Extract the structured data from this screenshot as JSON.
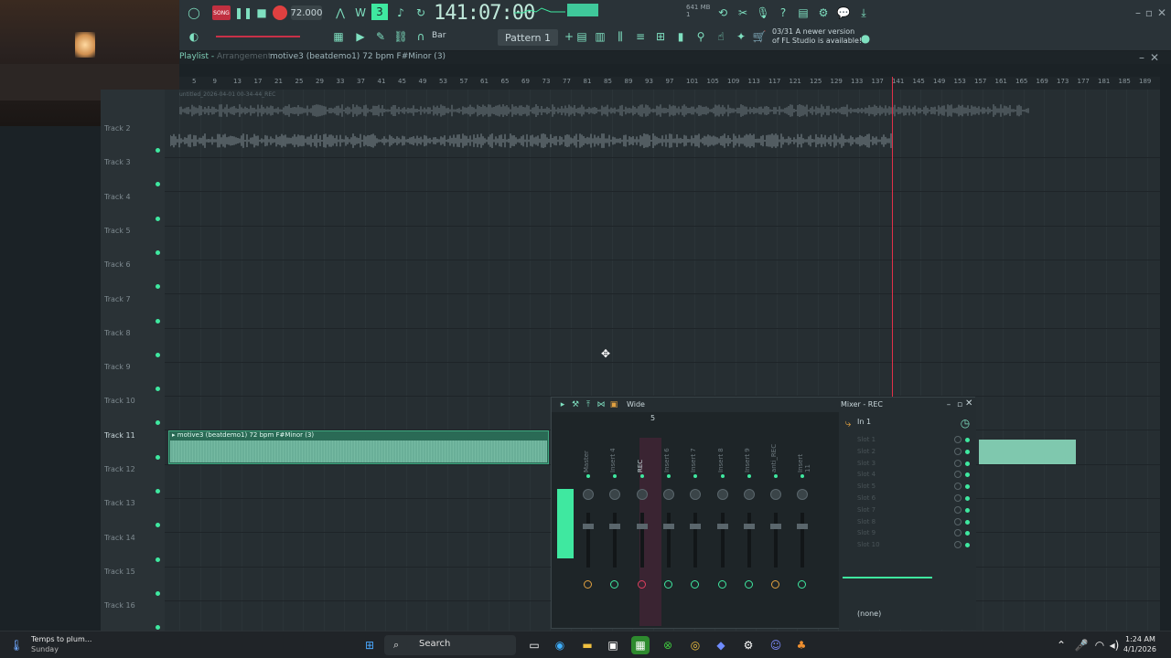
{
  "toolbar": {
    "song_badge": "SONG",
    "tempo": "72.000",
    "time": "141:07:00",
    "snap": "Bar",
    "pattern": "Pattern 1",
    "memory": "641 MB",
    "memory_sub": "1",
    "news_date": "03/31",
    "news_text": "A newer version of FL Studio is available!"
  },
  "playlist": {
    "title": "Playlist",
    "subtitle": "Arrangement",
    "pattern_name": "motive3 (beatdemo1) 72 bpm F#Minor (3)",
    "rec_clip_label": "untitled_2026-04-01 00-34-44_REC",
    "ruler_ticks": [
      "5",
      "9",
      "13",
      "17",
      "21",
      "25",
      "29",
      "33",
      "37",
      "41",
      "45",
      "49",
      "53",
      "57",
      "61",
      "65",
      "69",
      "73",
      "77",
      "81",
      "85",
      "89",
      "93",
      "97",
      "101",
      "105",
      "109",
      "113",
      "117",
      "121",
      "125",
      "129",
      "133",
      "137",
      "141",
      "145",
      "149",
      "153",
      "157",
      "161",
      "165",
      "169",
      "173",
      "177",
      "181",
      "185",
      "189"
    ],
    "tracks": [
      "Track 2",
      "Track 3",
      "Track 4",
      "Track 5",
      "Track 6",
      "Track 7",
      "Track 8",
      "Track 9",
      "Track 10",
      "Track 11",
      "Track 12",
      "Track 13",
      "Track 14",
      "Track 15",
      "Track 16"
    ],
    "clip_label": "motive3 (beatdemo1) 72 bpm F#Minor (3)"
  },
  "mixer": {
    "view": "Wide",
    "title": "Mixer - REC",
    "input": "In 1",
    "marker": "5",
    "channels": [
      "Master",
      "Insert 4",
      "REC",
      "Insert 6",
      "Insert 7",
      "Insert 8",
      "Insert 9",
      "anti_REC",
      "Insert 11"
    ],
    "slots": [
      "Slot 1",
      "Slot 2",
      "Slot 3",
      "Slot 4",
      "Slot 5",
      "Slot 6",
      "Slot 7",
      "Slot 8",
      "Slot 9",
      "Slot 10"
    ],
    "output": "(none)"
  },
  "taskbar": {
    "weather_title": "Temps to plum...",
    "weather_sub": "Sunday",
    "search": "Search",
    "time": "1:24 AM",
    "date": "4/1/2026"
  },
  "colors": {
    "accent": "#3fe8a0",
    "record": "#e04040",
    "playhead": "#e03048"
  }
}
